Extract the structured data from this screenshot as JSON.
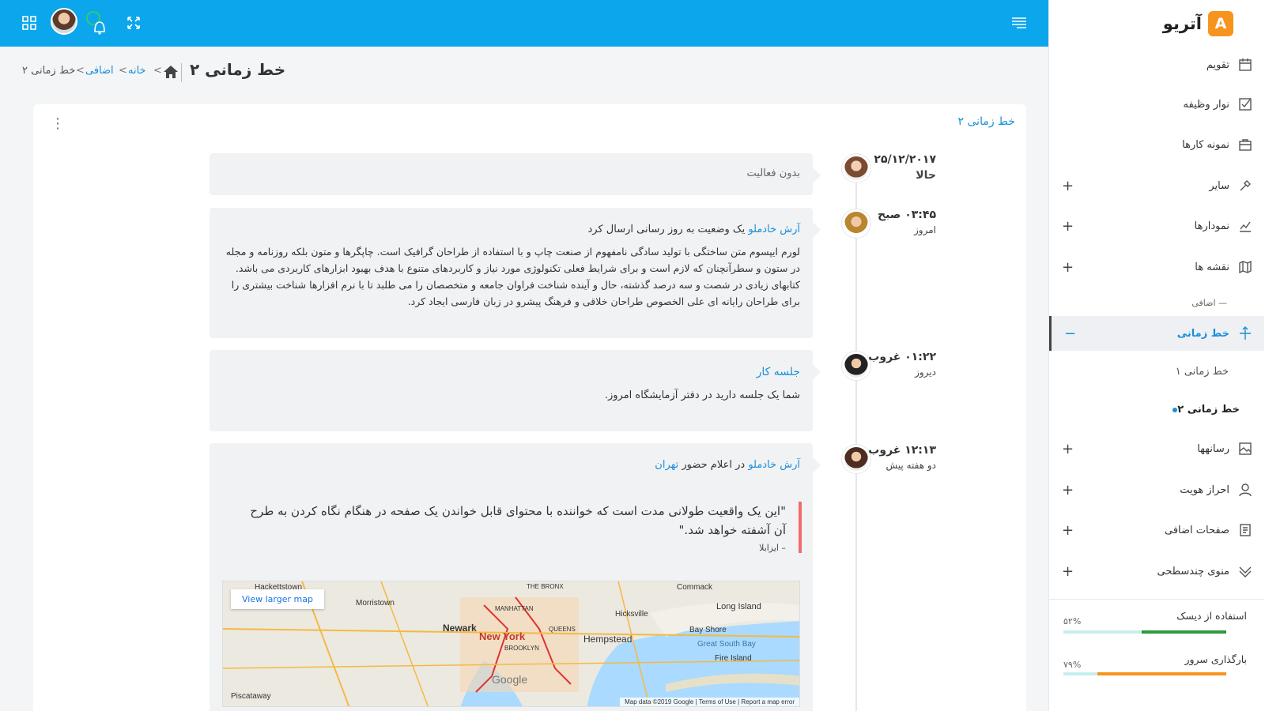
{
  "app": {
    "logo_letter": "A",
    "logo_text": "آتریو"
  },
  "topbar": {
    "icons": [
      "apps-grid-icon",
      "avatar",
      "bell-icon",
      "expand-icon",
      "menu-icon"
    ]
  },
  "breadcrumb": {
    "title": "خط زمانی ۲",
    "home": "home-icon",
    "items": [
      "خانه",
      "اضافی",
      "خط زمانی ۲"
    ],
    "sep": ">"
  },
  "sidebar": {
    "items": [
      {
        "label": "تقویم",
        "icon": "calendar-icon"
      },
      {
        "label": "نوار وظیفه",
        "icon": "checkbox-icon"
      },
      {
        "label": "نمونه کارها",
        "icon": "briefcase-icon"
      },
      {
        "label": "سایر",
        "icon": "tool-icon",
        "plus": "+"
      },
      {
        "label": "نمودارها",
        "icon": "chart-icon",
        "plus": "+"
      },
      {
        "label": "نقشه ها",
        "icon": "map-icon",
        "plus": "+"
      }
    ],
    "section": "— اضافی",
    "active": {
      "label": "خط زمانی",
      "icon": "timeline-icon",
      "minus": "−"
    },
    "sub_items": [
      "خط زمانی ۱",
      "خط زمانی ۲"
    ],
    "items2": [
      {
        "label": "رسانهها",
        "icon": "image-icon",
        "plus": "+"
      },
      {
        "label": "احراز هویت",
        "icon": "user-icon",
        "plus": "+"
      },
      {
        "label": "صفحات اضافی",
        "icon": "pages-icon",
        "plus": "+"
      },
      {
        "label": "منوی چندسطحی",
        "icon": "layers-icon",
        "plus": "+"
      }
    ],
    "stats": [
      {
        "label": "استفاده از دیسک",
        "pct": "۵۲%",
        "value": 0.52,
        "color": "#2e9b3c"
      },
      {
        "label": "بارگذاری سرور",
        "pct": "۷۹%",
        "value": 0.79,
        "color": "#f7941d"
      }
    ]
  },
  "card": {
    "title": "خط زمانی ۲",
    "menu": "⋮"
  },
  "timeline": [
    {
      "date": "۲۵/۱۲/۲۰۱۷",
      "sub": "حالا",
      "text": "بدون فعالیت"
    },
    {
      "date": "۰۳:۴۵ صبح",
      "sub": "امروز",
      "author": "آرش خادملو",
      "action": "یک وضعیت به روز رسانی ارسال کرد",
      "para": "لورم ایپسوم متن ساختگی با تولید سادگی نامفهوم از صنعت چاپ و با استفاده از طراحان گرافیک است. چاپگرها و متون بلکه روزنامه و مجله در ستون و سطرآنچنان که لازم است و برای شرایط فعلی تکنولوژی مورد نیاز و کاربردهای متنوع با هدف بهبود ابزارهای کاربردی می باشد. کتابهای زیادی در شصت و سه درصد گذشته، حال و آینده شناخت فراوان جامعه و متخصصان را می طلبد تا با نرم افزارها شناخت بیشتری را برای طراحان رایانه ای علی الخصوص طراحان خلاقی و فرهنگ پیشرو در زبان فارسی ایجاد کرد."
    },
    {
      "date": "۰۱:۲۲ غروب",
      "sub": "دیروز",
      "title": "جلسه کار",
      "text": "شما یک جلسه دارید در دفتر آزمایشگاه امروز."
    },
    {
      "date": "۱۲:۱۳ غروب",
      "sub": "دو هفته پیش",
      "author": "آرش خادملو",
      "action": "در اعلام حضور",
      "place": "تهران",
      "quote": "\"این یک واقعیت طولانی مدت است که خواننده با محتوای قابل خواندن یک صفحه در هنگام نگاه کردن به طرح آن آشفته خواهد شد.\"",
      "quote_src": "– ایزابلا",
      "map": {
        "button": "View larger map",
        "labels": [
          "Hackettstown",
          "Morristown",
          "Newark",
          "New York",
          "MANHATTAN",
          "THE BRONX",
          "QUEENS",
          "BROOKLYN",
          "Hicksville",
          "Hempstead",
          "Long Island",
          "Bay Shore",
          "Great South Bay",
          "Fire Island",
          "Commack",
          "Piscataway",
          "Google"
        ],
        "footer": "Map data ©2019 Google  |  Terms of Use  |  Report a map error"
      }
    }
  ]
}
